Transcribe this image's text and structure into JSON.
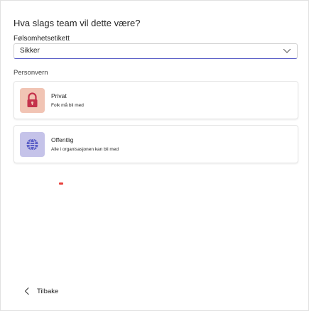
{
  "dialog": {
    "title": "Hva slags team vil dette være?"
  },
  "sensitivity": {
    "label": "Følsomhetsetikett",
    "selected_value": "Sikker",
    "chevron_icon": "chevron-down-icon"
  },
  "privacy": {
    "section_label": "Personvern",
    "options": [
      {
        "title": "Privat",
        "description": "Folk må bli med",
        "icon": "lock-icon",
        "icon_bg": "#f1c4b4",
        "icon_color": "#c4314b"
      },
      {
        "title": "Offentlig",
        "description": "Alle i organisasjonen kan bli med",
        "icon": "globe-icon",
        "icon_bg": "#c5c3e9",
        "icon_color": "#5b5fc7"
      }
    ]
  },
  "footer": {
    "back_label": "Tilbake",
    "back_icon": "chevron-left-icon"
  },
  "colors": {
    "accent": "#5b5fc7",
    "text": "#242424",
    "card_border": "#e6e6e6"
  }
}
